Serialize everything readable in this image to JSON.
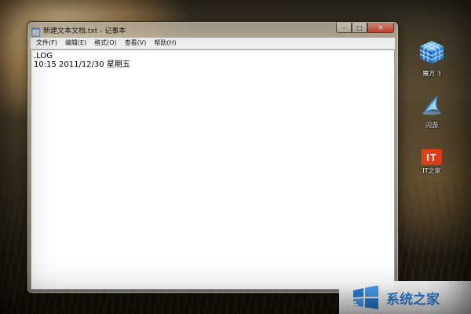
{
  "window": {
    "title": "新建文本文档.txt - 记事本",
    "caption_buttons": {
      "minimize": "–",
      "maximize": "□",
      "close": "✕"
    },
    "icon": "notepad-icon"
  },
  "menubar": {
    "items": [
      {
        "label": "文件(F)"
      },
      {
        "label": "编辑(E)"
      },
      {
        "label": "格式(O)"
      },
      {
        "label": "查看(V)"
      },
      {
        "label": "帮助(H)"
      }
    ]
  },
  "editor": {
    "lines": [
      ".LOG",
      "10:15 2011/12/30 星期五"
    ]
  },
  "desktop": {
    "icons": [
      {
        "label": "魔方 3",
        "icon": "rubiks-cube-icon"
      },
      {
        "label": "闪游",
        "icon": "flash-browser-icon"
      },
      {
        "label": "IT之家",
        "icon": "ithome-icon",
        "logo_text": "IT"
      }
    ]
  },
  "watermark": {
    "text": "系统之家",
    "color": "#2c7fd6"
  }
}
